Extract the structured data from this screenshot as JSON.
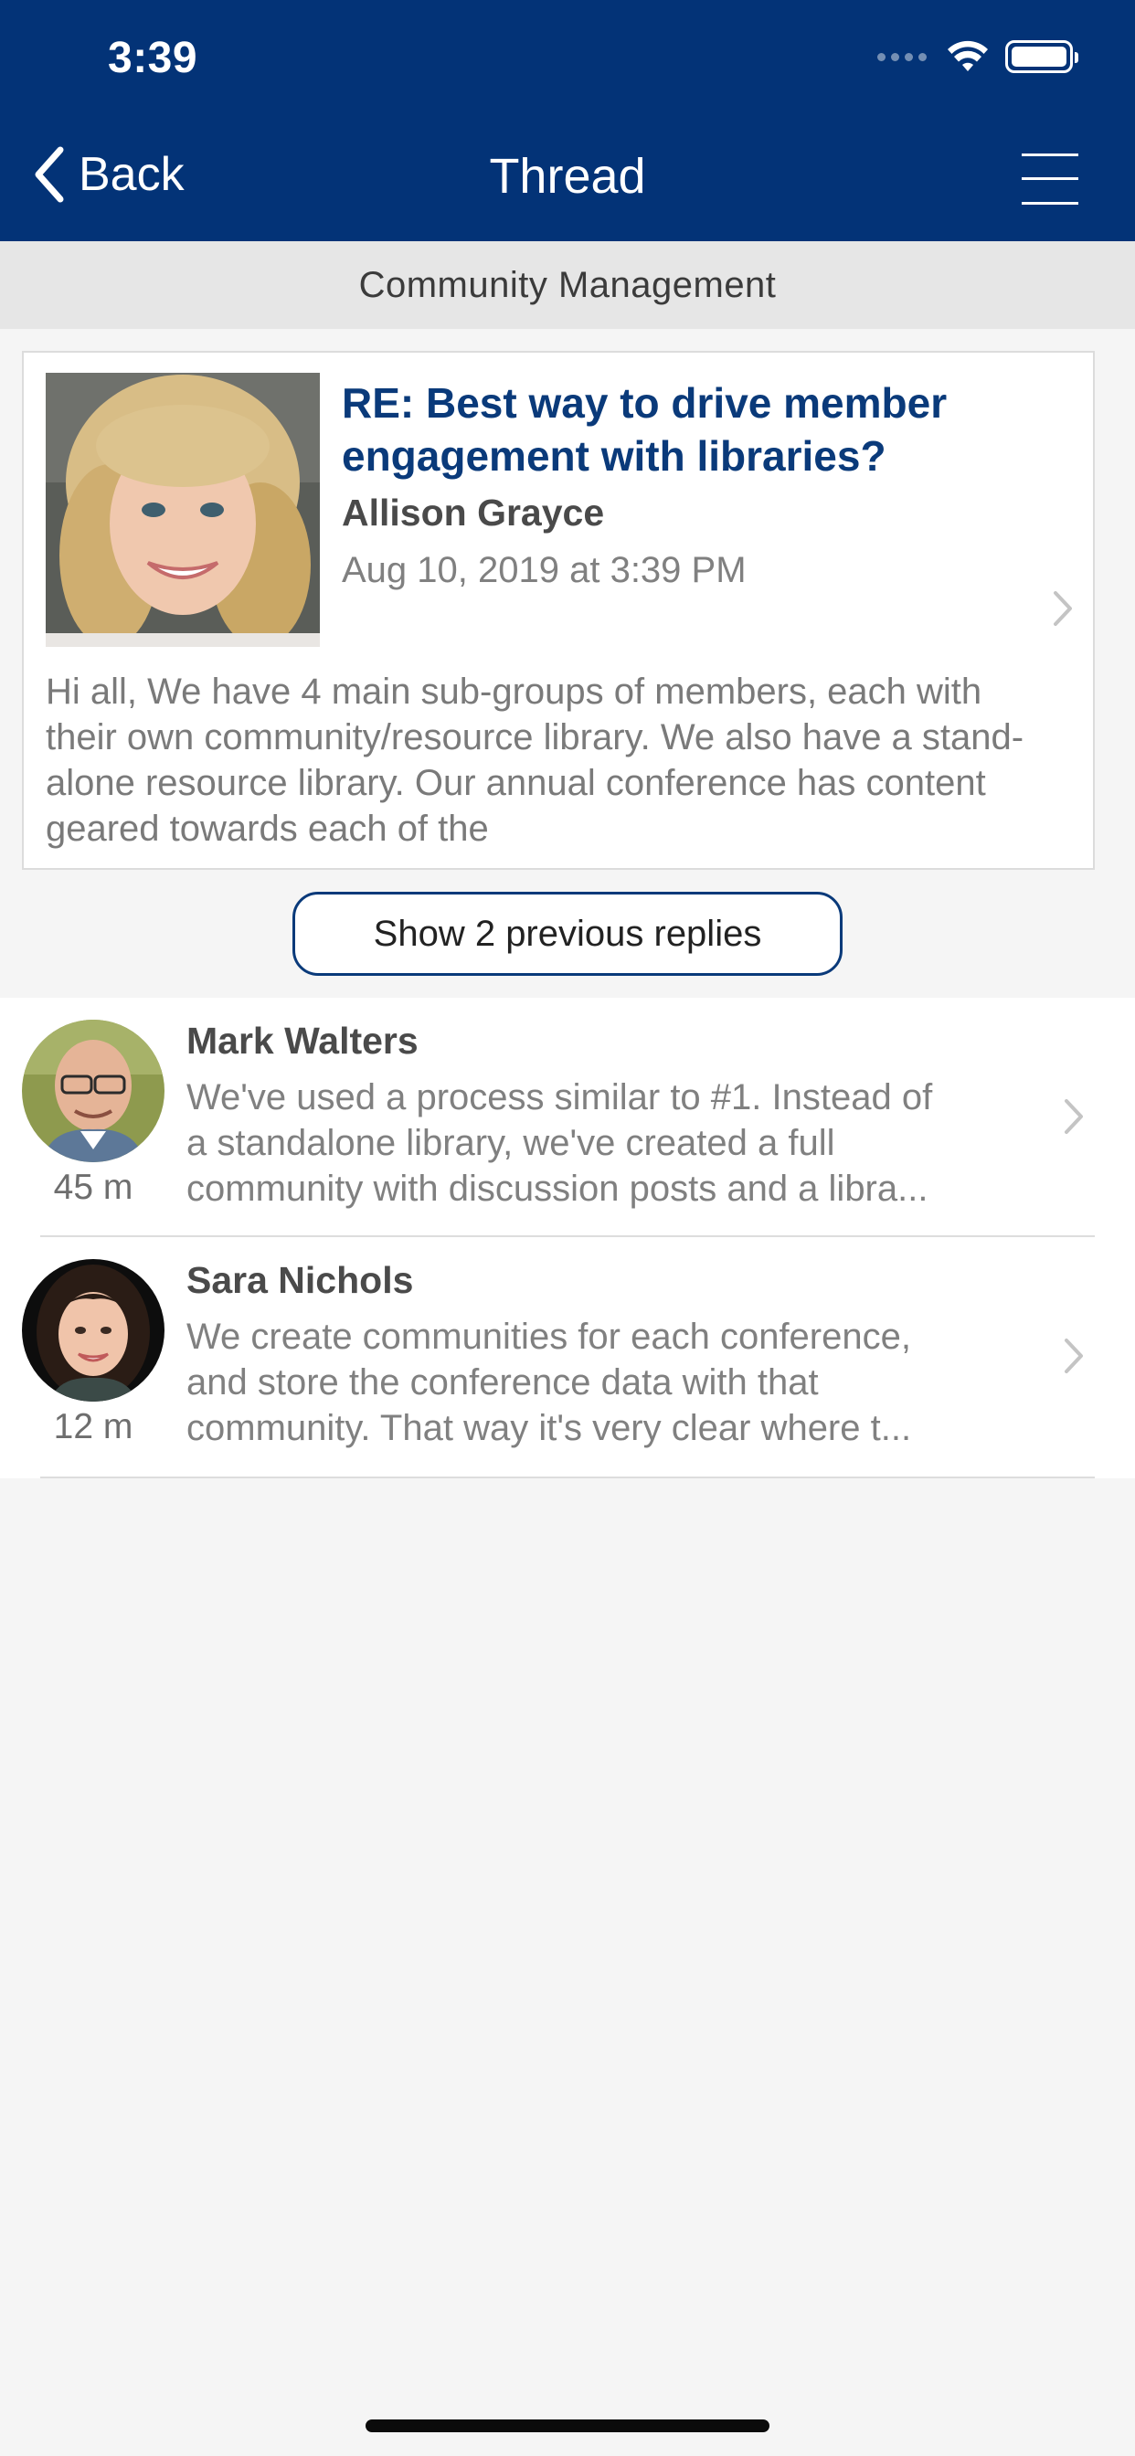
{
  "status_bar": {
    "time": "3:39"
  },
  "nav": {
    "back_label": "Back",
    "title": "Thread"
  },
  "subheader": {
    "group_name": "Community Management"
  },
  "post": {
    "title": "RE: Best way to drive member engagement with libraries?",
    "author": "Allison Grayce",
    "date": "Aug 10, 2019 at 3:39 PM",
    "body": "Hi all, We have 4 main sub-groups of members, each with their own community/resource library. We also have a stand-alone resource library. Our annual conference has content geared towards each of the"
  },
  "show_previous": {
    "label": "Show 2 previous replies"
  },
  "replies": [
    {
      "name": "Mark Walters",
      "age": "45 m",
      "lines": [
        "We've used a process similar to #1. Instead of",
        "a standalone library, we've created a full",
        "community with discussion posts and a libra..."
      ]
    },
    {
      "name": "Sara Nichols",
      "age": "12 m",
      "lines": [
        "We create communities for each conference,",
        "and store the conference data with that",
        "community.  That way it's very clear where t..."
      ]
    }
  ],
  "colors": {
    "brand": "#033377",
    "title_blue": "#0a3a7a",
    "subheader_bg": "#e6e6e6",
    "page_bg": "#f5f5f5"
  },
  "icons": {
    "back": "chevron-left-icon",
    "menu": "hamburger-menu-icon",
    "row_chevron": "chevron-right-icon",
    "wifi": "wifi-icon",
    "battery": "battery-icon",
    "signal": "cellular-signal-icon"
  }
}
